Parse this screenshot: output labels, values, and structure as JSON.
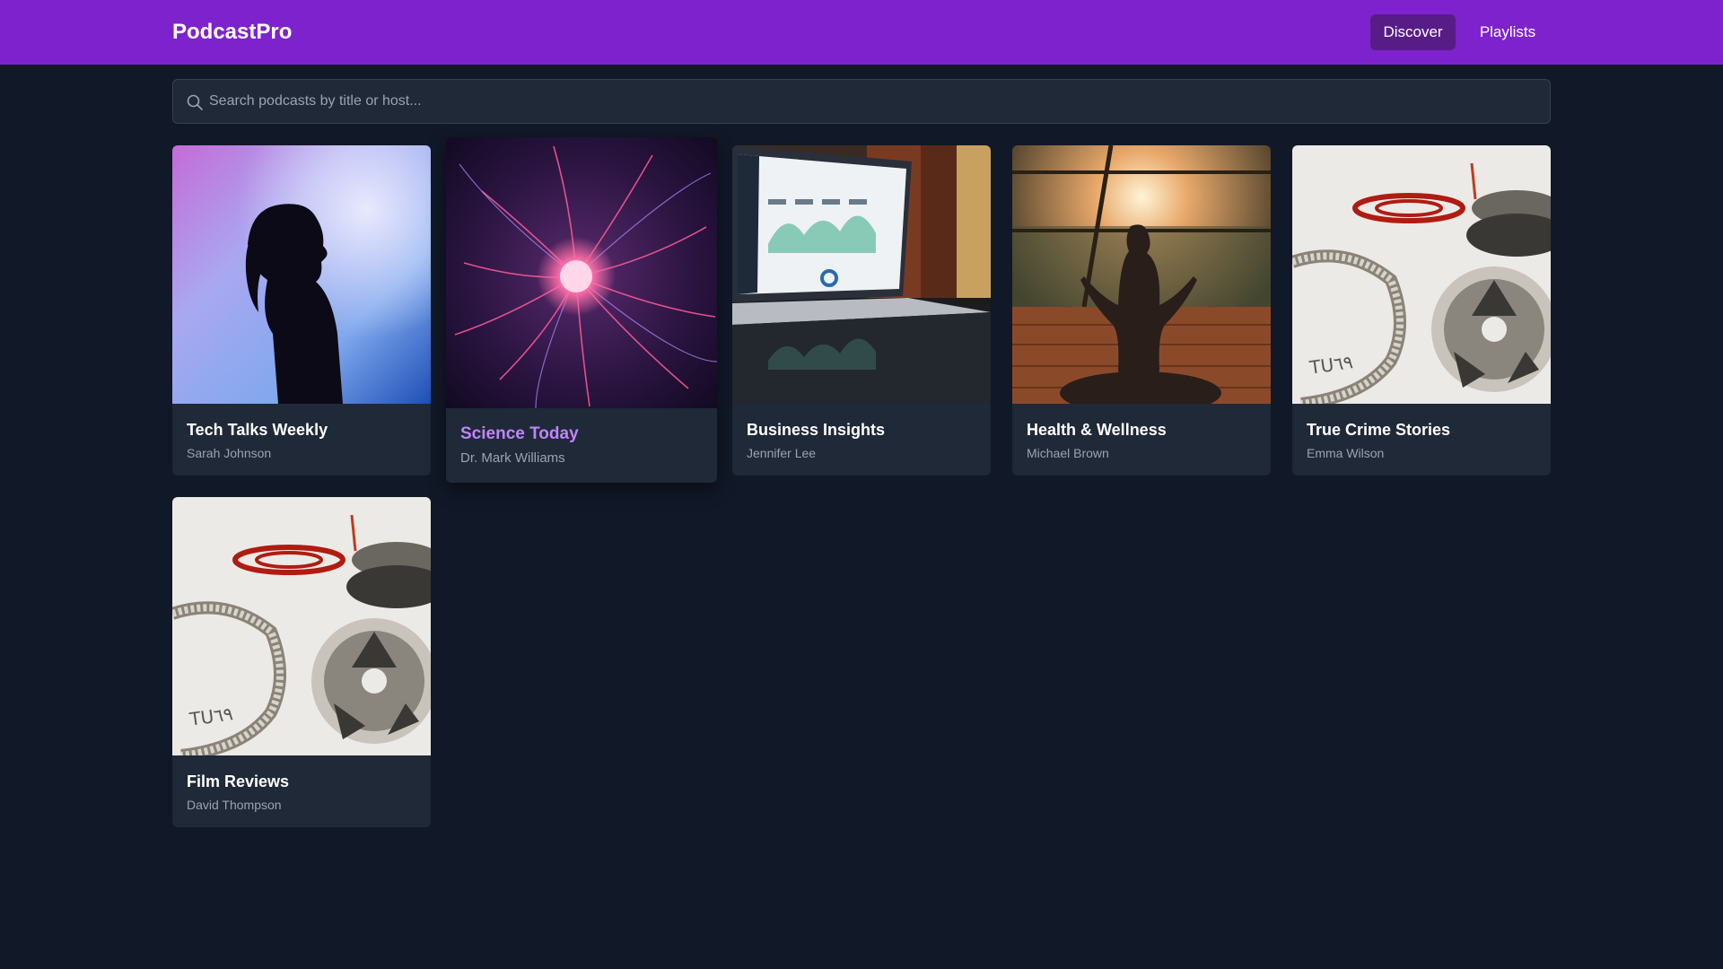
{
  "app": {
    "brand": "PodcastPro",
    "nav": [
      {
        "label": "Discover",
        "active": true
      },
      {
        "label": "Playlists",
        "active": false
      }
    ]
  },
  "search": {
    "placeholder": "Search podcasts by title or host...",
    "value": "",
    "icon": "search-icon"
  },
  "podcasts": [
    {
      "title": "Tech Talks Weekly",
      "host": "Sarah Johnson",
      "cover": "silhouette-portrait"
    },
    {
      "title": "Science Today",
      "host": "Dr. Mark Williams",
      "cover": "plasma-ball",
      "hovered": true
    },
    {
      "title": "Business Insights",
      "host": "Jennifer Lee",
      "cover": "laptop-dashboard"
    },
    {
      "title": "Health & Wellness",
      "host": "Michael Brown",
      "cover": "meditation-sunset"
    },
    {
      "title": "True Crime Stories",
      "host": "Emma Wilson",
      "cover": "film-reels"
    },
    {
      "title": "Film Reviews",
      "host": "David Thompson",
      "cover": "film-reels"
    }
  ],
  "colors": {
    "header": "#7e22ce",
    "active_nav": "#581c87",
    "background": "#111827",
    "card": "#1f2937",
    "hover_title": "#c084fc",
    "muted_text": "#9ca3af"
  }
}
